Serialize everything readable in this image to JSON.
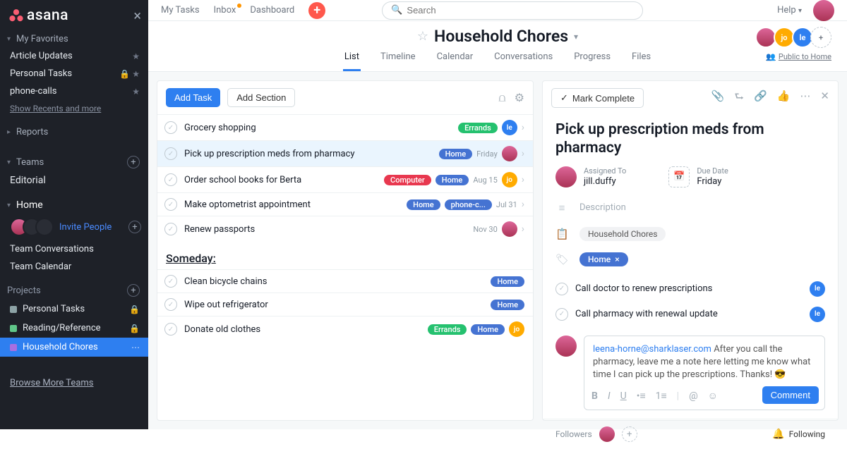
{
  "brand": "asana",
  "top_nav": {
    "my_tasks": "My Tasks",
    "inbox": "Inbox",
    "dashboard": "Dashboard",
    "search_placeholder": "Search",
    "help": "Help"
  },
  "sidebar": {
    "favorites_header": "My Favorites",
    "fav_items": [
      {
        "label": "Article Updates",
        "icons": [
          "star"
        ]
      },
      {
        "label": "Personal Tasks",
        "icons": [
          "lock",
          "star"
        ]
      },
      {
        "label": "phone-calls",
        "icons": [
          "star"
        ]
      }
    ],
    "recents_link": "Show Recents and more",
    "reports_header": "Reports",
    "teams_header": "Teams",
    "team_editorial": "Editorial",
    "team_home": "Home",
    "invite": "Invite People",
    "team_links": [
      "Team Conversations",
      "Team Calendar"
    ],
    "projects_header": "Projects",
    "projects": [
      {
        "label": "Personal Tasks",
        "color": "#8da3a6",
        "locked": true,
        "active": false
      },
      {
        "label": "Reading/Reference",
        "color": "#60c689",
        "locked": true,
        "active": false
      },
      {
        "label": "Household Chores",
        "color": "#a96fe0",
        "locked": false,
        "active": true
      }
    ],
    "browse": "Browse More Teams"
  },
  "project_header": {
    "title": "Household Chores",
    "tabs": [
      "List",
      "Timeline",
      "Calendar",
      "Conversations",
      "Progress",
      "Files"
    ],
    "active_tab": 0,
    "members": [
      {
        "type": "image",
        "bg": "linear-gradient(#d69,#a35)"
      },
      {
        "type": "initials",
        "text": "jo",
        "bg": "#ffab00"
      },
      {
        "type": "initials",
        "text": "le",
        "bg": "#2e7ff0"
      }
    ],
    "visibility": "Public to Home"
  },
  "list_toolbar": {
    "add_task": "Add Task",
    "add_section": "Add Section"
  },
  "tasks": {
    "main": [
      {
        "title": "Grocery shopping",
        "pills": [
          {
            "text": "Errands",
            "color": "green"
          }
        ],
        "due": "",
        "assignee": {
          "text": "le",
          "bg": "#2e7ff0"
        },
        "selected": false
      },
      {
        "title": "Pick up prescription meds from pharmacy",
        "pills": [
          {
            "text": "Home",
            "color": "blue"
          }
        ],
        "due": "Friday",
        "assignee": {
          "type": "image"
        },
        "selected": true
      },
      {
        "title": "Order school books for Berta",
        "pills": [
          {
            "text": "Computer",
            "color": "red"
          },
          {
            "text": "Home",
            "color": "blue"
          }
        ],
        "due": "Aug 15",
        "assignee": {
          "text": "jo",
          "bg": "#ffab00"
        },
        "selected": false
      },
      {
        "title": "Make optometrist appointment",
        "pills": [
          {
            "text": "Home",
            "color": "blue"
          },
          {
            "text": "phone-c...",
            "color": "blue"
          }
        ],
        "due": "Jul 31",
        "assignee": null,
        "selected": false
      },
      {
        "title": "Renew passports",
        "pills": [],
        "due": "Nov 30",
        "assignee": {
          "type": "image"
        },
        "selected": false
      }
    ],
    "section_header": "Someday:",
    "someday": [
      {
        "title": "Clean bicycle chains",
        "pills": [
          {
            "text": "Home",
            "color": "blue"
          }
        ],
        "assignee": null
      },
      {
        "title": "Wipe out refrigerator",
        "pills": [
          {
            "text": "Home",
            "color": "blue"
          }
        ],
        "assignee": null
      },
      {
        "title": "Donate old clothes",
        "pills": [
          {
            "text": "Errands",
            "color": "green"
          },
          {
            "text": "Home",
            "color": "blue"
          }
        ],
        "assignee": {
          "text": "jo",
          "bg": "#ffab00"
        }
      }
    ]
  },
  "detail": {
    "mark_complete": "Mark Complete",
    "title": "Pick up prescription meds from pharmacy",
    "assigned_to_label": "Assigned To",
    "assigned_to": "jill.duffy",
    "due_label": "Due Date",
    "due_value": "Friday",
    "description_label": "Description",
    "project_chip": "Household Chores",
    "tag_chip": "Home",
    "subtasks": [
      {
        "title": "Call doctor to renew prescriptions",
        "assignee": {
          "text": "le",
          "bg": "#2e7ff0"
        }
      },
      {
        "title": "Call pharmacy with renewal update",
        "assignee": {
          "text": "le",
          "bg": "#2e7ff0"
        }
      }
    ],
    "comment_author": "leena-horne@sharklaser.com",
    "comment_text": " After you call the pharmacy, leave me a note here letting me know what time I can pick up the prescriptions. Thanks! 😎",
    "comment_button": "Comment",
    "followers_label": "Followers",
    "following_label": "Following"
  }
}
